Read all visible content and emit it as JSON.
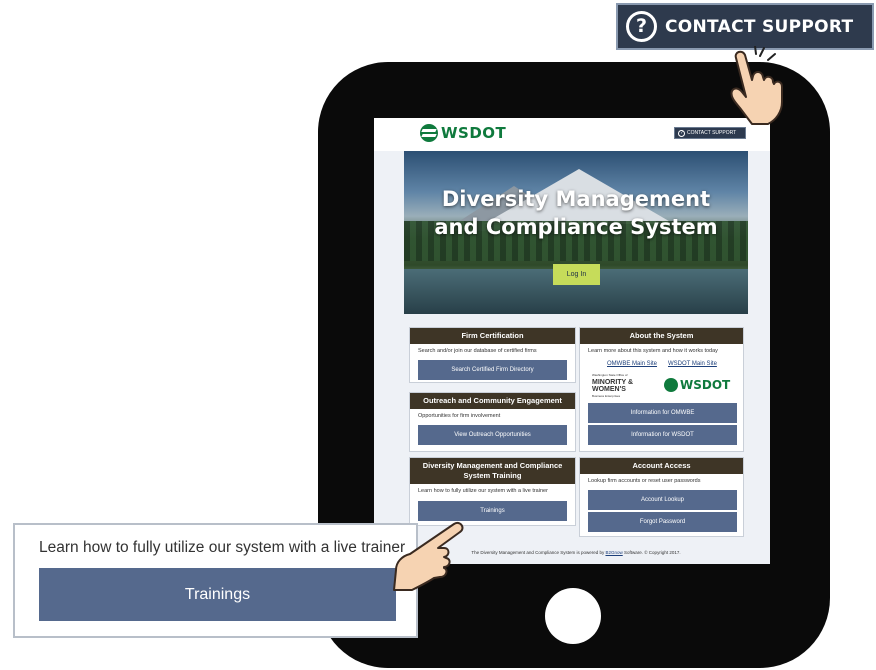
{
  "contact": {
    "label": "CONTACT SUPPORT",
    "icon": "question-circle-icon"
  },
  "screen": {
    "brand": "WSDOT",
    "mini_contact_label": "CONTACT SUPPORT",
    "hero": {
      "title_line1": "Diversity Management",
      "title_line2": "and Compliance System",
      "login_label": "Log In"
    },
    "panels": {
      "firm": {
        "title": "Firm Certification",
        "desc": "Search and/or join our database of certified firms",
        "button": "Search Certified Firm Directory"
      },
      "about": {
        "title": "About the System",
        "desc": "Learn more about this system and how it works today",
        "link1": "OMWBE Main Site",
        "link2": "WSDOT Main Site",
        "omwbe_top": "Washington State Office of",
        "omwbe_mid1": "MINORITY &",
        "omwbe_mid2": "WOMEN'S",
        "omwbe_bottom": "Business Enterprises",
        "wsdot": "WSDOT",
        "btn1": "Information for OMWBE",
        "btn2": "Information for WSDOT"
      },
      "outreach": {
        "title": "Outreach and Community Engagement",
        "desc": "Opportunities for firm involvement",
        "button": "View Outreach Opportunities"
      },
      "training": {
        "title": "Diversity Management and Compliance System Training",
        "desc": "Learn how to fully utilize our system with a live trainer",
        "button": "Trainings"
      },
      "account": {
        "title": "Account Access",
        "desc": "Lookup firm accounts or reset user passwords",
        "btn1": "Account Lookup",
        "btn2": "Forgot Password"
      }
    },
    "footer": {
      "pre": "The Diversity Management and Compliance System is powered by ",
      "link": "B2Gnow",
      "post": " Software. © Copyright 2017."
    }
  },
  "callout": {
    "text": "Learn how to fully utilize our system with a live trainer",
    "button": "Trainings"
  },
  "colors": {
    "tablet": "#0a0a0a",
    "panel_head": "#3e3526",
    "button": "#55698d",
    "brand_green": "#0f7a3d",
    "login": "#c6dc5a"
  }
}
